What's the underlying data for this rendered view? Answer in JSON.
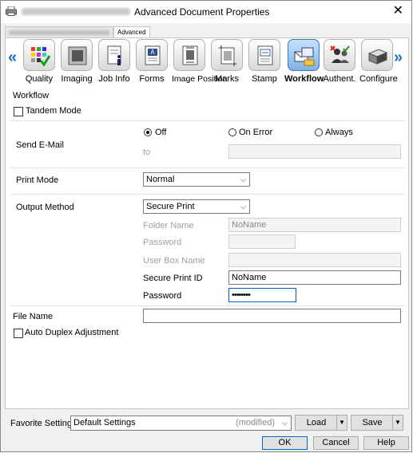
{
  "window": {
    "title": "Advanced Document Properties",
    "close_glyph": "✕"
  },
  "tabs": {
    "active": "Advanced"
  },
  "toolbar": {
    "items": [
      {
        "label": "Quality"
      },
      {
        "label": "Imaging"
      },
      {
        "label": "Job Info"
      },
      {
        "label": "Forms"
      },
      {
        "label": "Image Position"
      },
      {
        "label": "Marks"
      },
      {
        "label": "Stamp"
      },
      {
        "label": "Workflow",
        "selected": true
      },
      {
        "label": "Authent."
      },
      {
        "label": "Configure"
      }
    ],
    "accent": "#1a6fc4"
  },
  "workflow": {
    "heading": "Workflow",
    "tandem_mode": {
      "label": "Tandem Mode",
      "checked": false
    },
    "send_email": {
      "label": "Send E-Mail",
      "options": [
        "Off",
        "On Error",
        "Always"
      ],
      "selected": "Off",
      "to_label": "to",
      "to_value": ""
    },
    "print_mode": {
      "label": "Print Mode",
      "value": "Normal"
    },
    "output_method": {
      "label": "Output Method",
      "value": "Secure Print",
      "folder_name_label": "Folder Name",
      "folder_name_value": "NoName",
      "password_label": "Password",
      "user_box_name_label": "User Box Name",
      "secure_print_id_label": "Secure Print ID",
      "secure_print_id_value": "NoName",
      "secure_password_label": "Password",
      "secure_password_value": "••••••••"
    },
    "file_name": {
      "label": "File Name",
      "value": ""
    },
    "auto_duplex": {
      "label": "Auto Duplex Adjustment",
      "checked": false
    }
  },
  "bottom": {
    "favorite_label": "Favorite Setting",
    "favorite_value": "Default Settings",
    "favorite_status": "(modified)",
    "load_label": "Load",
    "save_label": "Save"
  },
  "footer": {
    "ok": "OK",
    "cancel": "Cancel",
    "help": "Help"
  }
}
